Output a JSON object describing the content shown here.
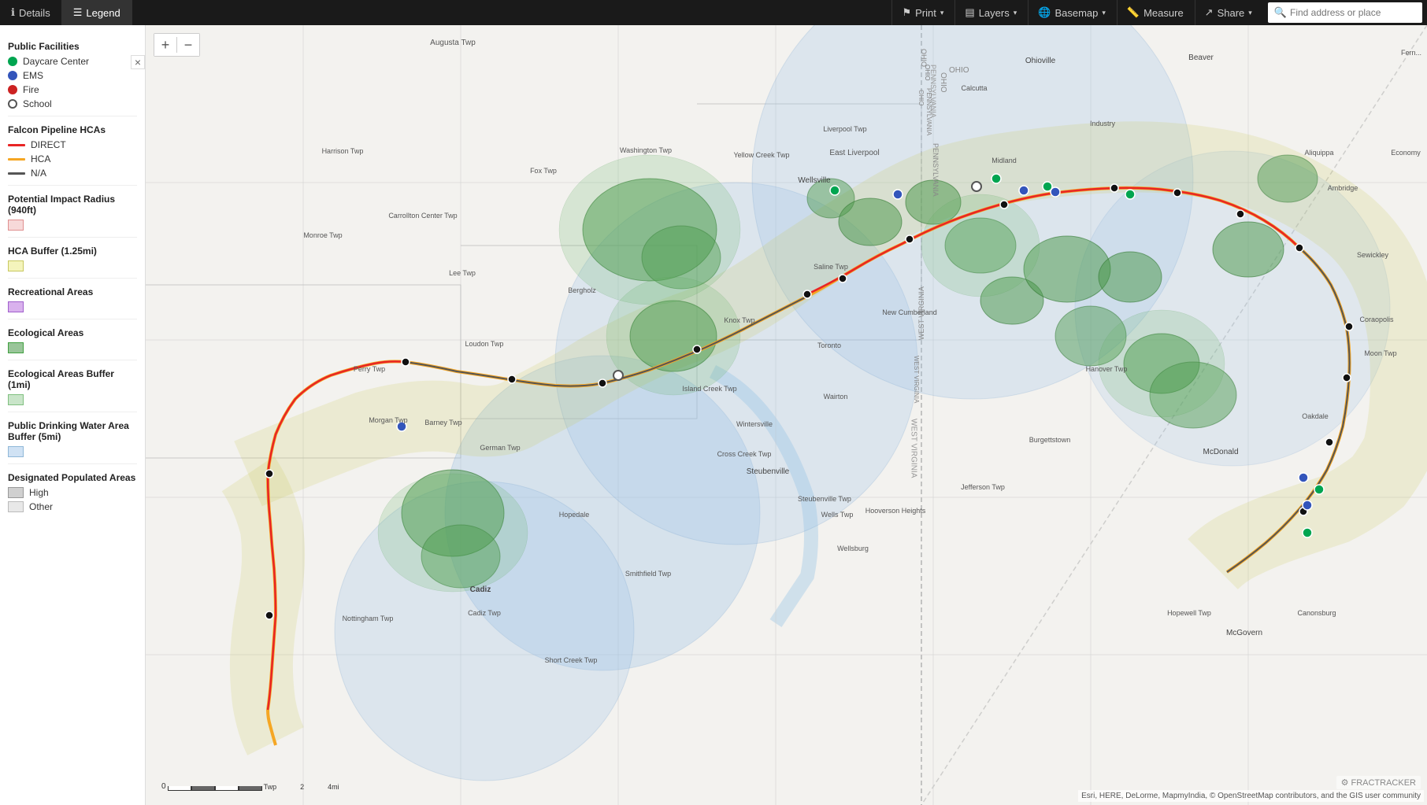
{
  "toolbar": {
    "details_tab": "Details",
    "legend_tab": "Legend",
    "print_btn": "Print",
    "layers_btn": "Layers",
    "basemap_btn": "Basemap",
    "measure_btn": "Measure",
    "share_btn": "Share",
    "search_placeholder": "Find address or place"
  },
  "legend": {
    "close_label": "×",
    "public_facilities_title": "Public Facilities",
    "items_facilities": [
      {
        "label": "Daycare Center",
        "type": "dot",
        "color": "#00a550",
        "border": "#00a550"
      },
      {
        "label": "EMS",
        "type": "dot",
        "color": "#3355bb",
        "border": "#3355bb"
      },
      {
        "label": "Fire",
        "type": "dot",
        "color": "#cc2222",
        "border": "#cc2222"
      },
      {
        "label": "School",
        "type": "dot",
        "color": "#fff",
        "border": "#555"
      }
    ],
    "falcon_hca_title": "Falcon Pipeline HCAs",
    "items_pipeline": [
      {
        "label": "DIRECT",
        "type": "line",
        "color": "#e82525"
      },
      {
        "label": "HCA",
        "type": "line",
        "color": "#f5a623"
      },
      {
        "label": "N/A",
        "type": "line",
        "color": "#555"
      }
    ],
    "pir_title": "Potential Impact Radius (940ft)",
    "pir_color": "#f5b8b8",
    "hca_buffer_title": "HCA Buffer (1.25mi)",
    "hca_buffer_color": "#f0f0b0",
    "rec_title": "Recreational Areas",
    "rec_color": "#b070e0",
    "eco_title": "Ecological Areas",
    "eco_color": "#60b060",
    "eco_buf_title": "Ecological Areas Buffer (1mi)",
    "eco_buf_color": "#90c890",
    "drinking_water_title": "Public Drinking Water Area Buffer (5mi)",
    "drinking_water_color": "#b0c8e8",
    "designated_pop_title": "Designated Populated Areas",
    "items_dpa": [
      {
        "label": "High",
        "type": "swatch",
        "color": "#d0d0d0",
        "border": "#999"
      },
      {
        "label": "Other",
        "type": "swatch",
        "color": "#e8e8e8",
        "border": "#bbb"
      }
    ]
  },
  "map": {
    "zoom_in": "+",
    "zoom_out": "−",
    "scale_labels": [
      "0",
      "Twp",
      "2",
      "4mi"
    ],
    "attribution": "Esri, HERE, DeLorme, MapmyIndia, © OpenStreetMap contributors, and the GIS user community",
    "fractracker_label": "⚙ FRACTRACKER",
    "towns": [
      "Augusta Twp",
      "Harrison Twp",
      "Fox Twp",
      "Carrollton Center Twp",
      "Monroe Twp",
      "Lee Twp",
      "Bergholz",
      "Perry Twp",
      "Loudon Twp",
      "Barney Twp",
      "Morgan Twp",
      "German Twp",
      "Hopedale",
      "Nottingham Twp",
      "Cadiz Twp",
      "Cadiz",
      "Short Creek Twp",
      "Smithfield Twp",
      "Washington Twp",
      "Knox Twp",
      "Toronto",
      "Wairton",
      "Saline Twp",
      "Wellsville",
      "Yellow Creek Twp",
      "East Liverpool",
      "Liverpool Twp",
      "New Cumberland",
      "Calcutta",
      "Ohioville",
      "Midland",
      "Industry",
      "Beaver",
      "Aliquippa",
      "Ambridge",
      "Sewickley",
      "Coraopolis",
      "Moon Twp",
      "McDonald",
      "Hopewell Twp",
      "McGovern",
      "Canonsburg",
      "Wells Twp",
      "Wellsburg",
      "Steubenville Twp",
      "Steubenville",
      "Wintersville",
      "Cross Creek Twp",
      "Island Creek Twp",
      "Hooverson Heights",
      "Jefferson Twp",
      "Burgettstown",
      "Hanover Twp",
      "Oakdale"
    ]
  }
}
